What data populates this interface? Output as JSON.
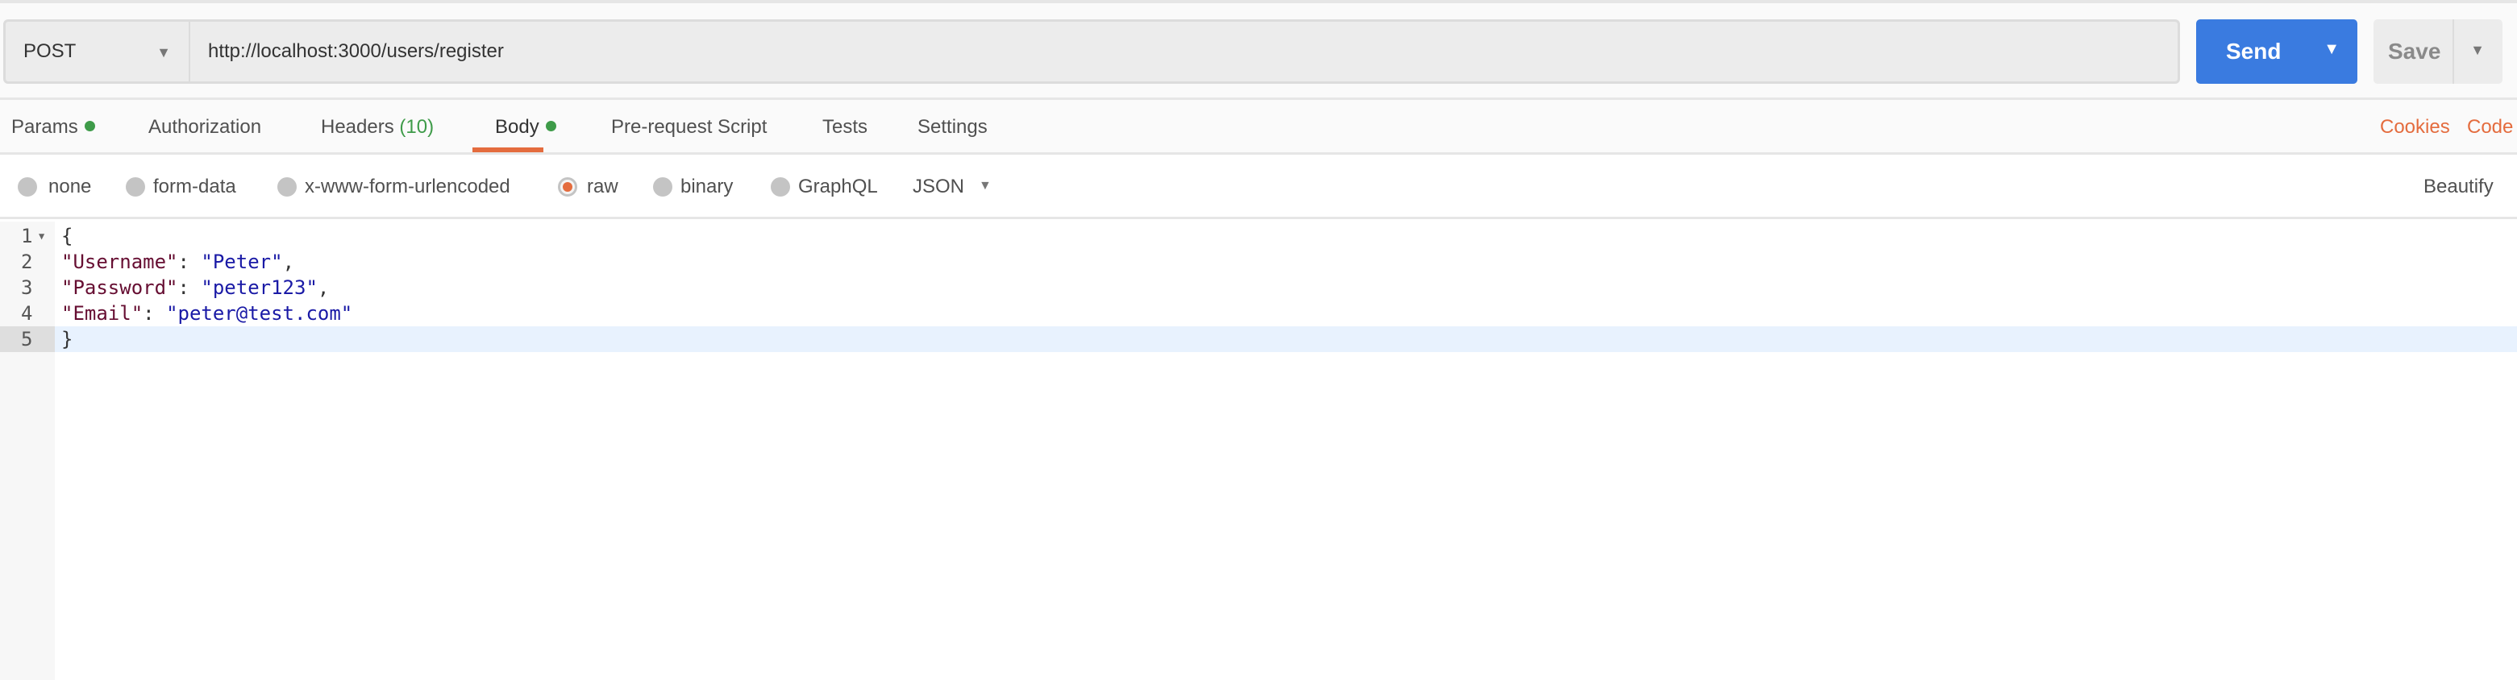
{
  "request": {
    "method": "POST",
    "url": "http://localhost:3000/users/register",
    "send_label": "Send",
    "save_label": "Save"
  },
  "tabs": [
    {
      "label": "Params",
      "dot": true
    },
    {
      "label": "Authorization"
    },
    {
      "label": "Headers",
      "count": "(10)"
    },
    {
      "label": "Body",
      "dot": true,
      "active": true
    },
    {
      "label": "Pre-request Script"
    },
    {
      "label": "Tests"
    },
    {
      "label": "Settings"
    }
  ],
  "tab_links": {
    "cookies": "Cookies",
    "code": "Code"
  },
  "body_types": [
    {
      "label": "none"
    },
    {
      "label": "form-data"
    },
    {
      "label": "x-www-form-urlencoded"
    },
    {
      "label": "raw",
      "selected": true
    },
    {
      "label": "binary"
    },
    {
      "label": "GraphQL"
    }
  ],
  "format": "JSON",
  "beautify_label": "Beautify",
  "editor": {
    "active_line": 5,
    "lines": [
      {
        "n": "1",
        "open": "{"
      },
      {
        "n": "2",
        "key": "\"Username\"",
        "sep": ": ",
        "val": "\"Peter\"",
        "end": ","
      },
      {
        "n": "3",
        "key": "\"Password\"",
        "sep": ": ",
        "val": "\"peter123\"",
        "end": ","
      },
      {
        "n": "4",
        "key": "\"Email\"",
        "sep": ": ",
        "val": "\"peter@test.com\"",
        "end": ""
      },
      {
        "n": "5",
        "close": "}"
      }
    ]
  },
  "colors": {
    "accent": "#e46c3e",
    "send": "#3a7be0",
    "indicator": "#3e9b49",
    "json_key": "#660e32",
    "json_string": "#1a1aa6"
  }
}
